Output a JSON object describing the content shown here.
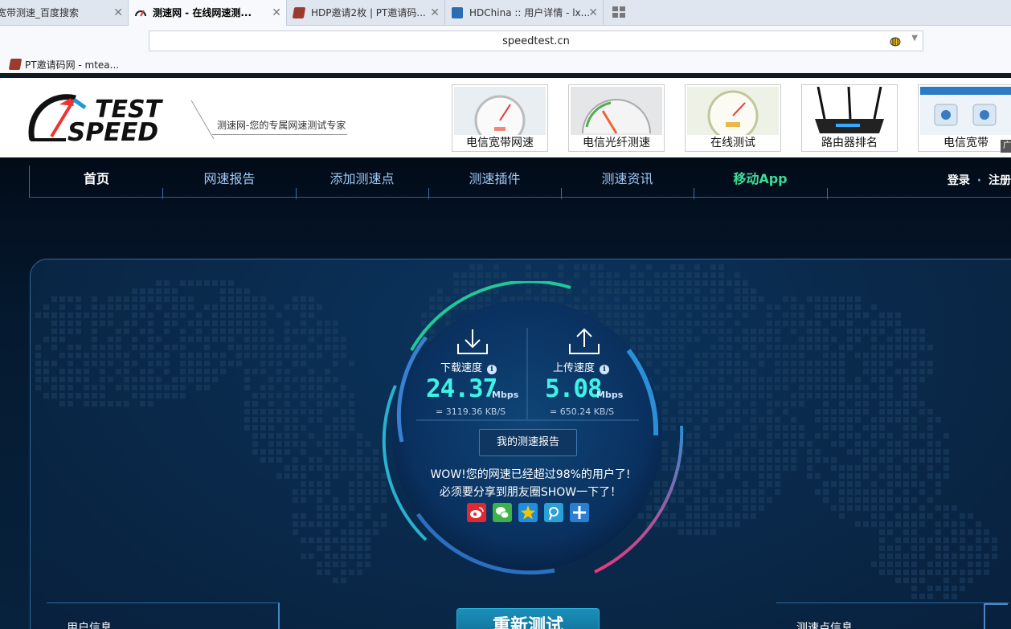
{
  "browser": {
    "tabs": [
      {
        "title": "宽带测速_百度搜索",
        "active": false
      },
      {
        "title": "测速网 - 在线网速测...",
        "active": true
      },
      {
        "title": "HDP邀请2枚 | PT邀请码...",
        "active": false
      },
      {
        "title": "HDChina :: 用户详情 - lx...",
        "active": false
      }
    ],
    "tab_close_glyph": "✕",
    "url": "speedtest.cn",
    "bookmark": "PT邀请码网 - mtea..."
  },
  "header": {
    "logo_text_top": "TEST",
    "logo_text_bottom": "SPEED",
    "tagline": "测速网-您的专属网速测试专家",
    "thumbs": [
      {
        "caption": "电信宽带网速"
      },
      {
        "caption": "电信光纤测速"
      },
      {
        "caption": "在线测试"
      },
      {
        "caption": "路由器排名"
      },
      {
        "caption": "电信宽带"
      }
    ],
    "corner_tag": "广"
  },
  "nav": {
    "items": [
      {
        "label": "首页"
      },
      {
        "label": "网速报告"
      },
      {
        "label": "添加测速点"
      },
      {
        "label": "测速插件"
      },
      {
        "label": "测速资讯"
      },
      {
        "label": "移动App"
      }
    ],
    "login": "登录",
    "dot": "·",
    "register": "注册"
  },
  "result": {
    "download": {
      "label": "下载速度",
      "value": "24.37",
      "unit": "Mbps",
      "kbps": "= 3119.36  KB/S"
    },
    "upload": {
      "label": "上传速度",
      "value": "5.08",
      "unit": "Mbps",
      "kbps": "= 650.24  KB/S"
    },
    "info_glyph": "i",
    "report_button": "我的测速报告",
    "wow_line1": "WOW!您的网速已经超过98%的用户了!",
    "wow_line2": "必须要分享到朋友圈SHOW一下了！",
    "share_icons": [
      "weibo-icon",
      "wechat-icon",
      "qzone-icon",
      "tencent-weibo-icon",
      "more-share-icon"
    ]
  },
  "bottom": {
    "user_info": "用户信息",
    "retest_button": "重新测试",
    "node_info": "测速点信息"
  },
  "colors": {
    "speed_value": "#3ef2e5",
    "app_nav": "#3ddc97",
    "arc_green": "#21c99a",
    "arc_blue": "#2a8fd6",
    "arc_pink": "#e83a7a"
  }
}
